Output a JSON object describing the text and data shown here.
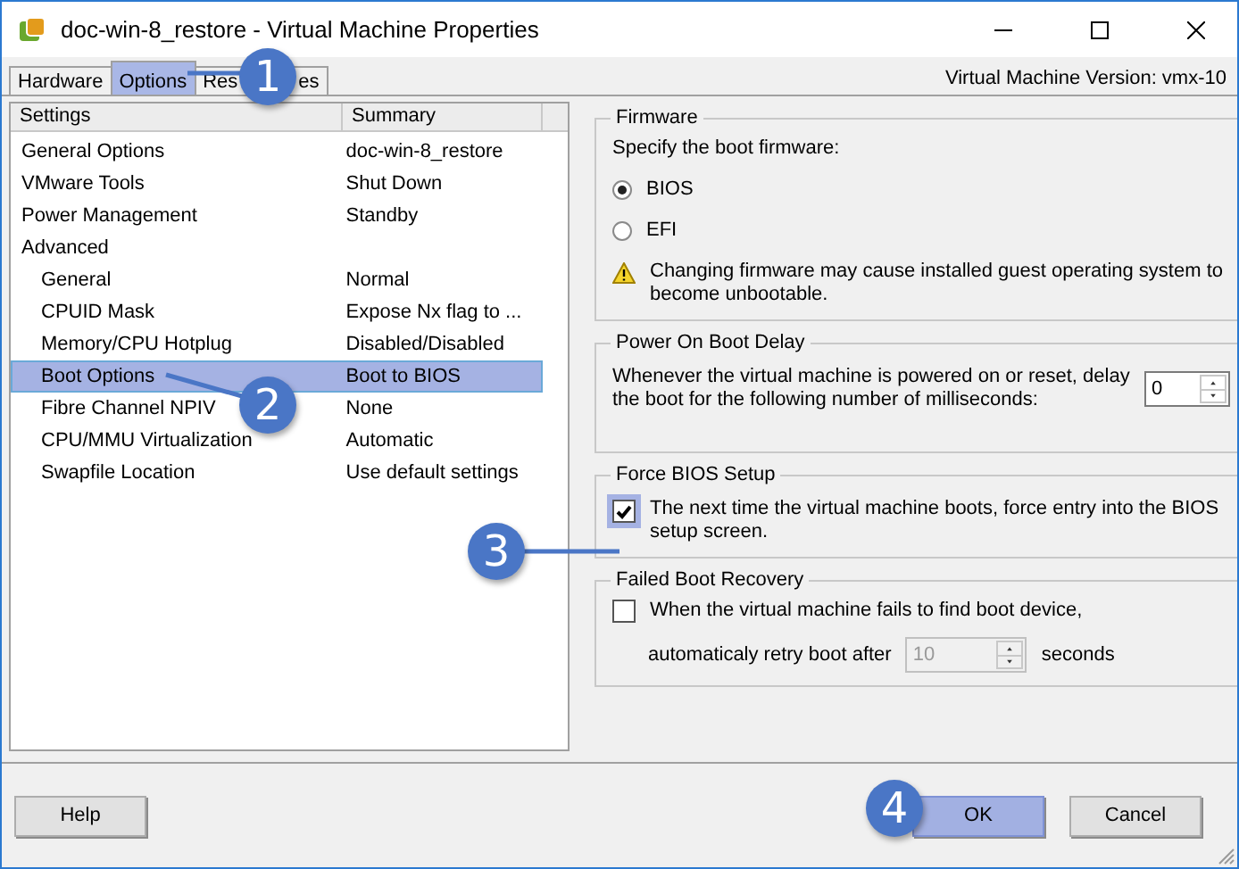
{
  "window": {
    "title": "doc-win-8_restore - Virtual Machine Properties"
  },
  "tabs": [
    {
      "label": "Hardware",
      "selected": false
    },
    {
      "label": "Options",
      "selected": true
    },
    {
      "label_parts": [
        "Res",
        "es"
      ],
      "selected": false
    }
  ],
  "version": "Virtual Machine Version: vmx-10",
  "settings_table": {
    "columns": [
      "Settings",
      "Summary"
    ],
    "rows": [
      {
        "setting": "General Options",
        "summary": "doc-win-8_restore",
        "selected": false
      },
      {
        "setting": "VMware Tools",
        "summary": "Shut Down",
        "selected": false
      },
      {
        "setting": "Power Management",
        "summary": "Standby",
        "selected": false
      },
      {
        "setting": "Advanced",
        "selected": false,
        "children": [
          {
            "setting": "General",
            "summary": "Normal",
            "selected": false
          },
          {
            "setting": "CPUID Mask",
            "summary": "Expose Nx flag to ...",
            "selected": false
          },
          {
            "setting": "Memory/CPU Hotplug",
            "summary": "Disabled/Disabled",
            "selected": false
          },
          {
            "setting": "Boot Options",
            "summary": "Boot to BIOS",
            "selected": true
          },
          {
            "setting": "Fibre Channel NPIV",
            "summary": "None",
            "selected": false
          },
          {
            "setting": "CPU/MMU Virtualization",
            "summary": "Automatic",
            "selected": false
          },
          {
            "setting": "Swapfile Location",
            "summary": "Use default settings",
            "selected": false
          }
        ]
      }
    ]
  },
  "firmware": {
    "title": "Firmware",
    "prompt": "Specify the boot firmware:",
    "options": [
      {
        "label": "BIOS",
        "selected": true
      },
      {
        "label": "EFI",
        "selected": false
      }
    ],
    "warning": "Changing firmware may cause installed guest operating system to become unbootable."
  },
  "boot_delay": {
    "title": "Power On Boot Delay",
    "description": "Whenever the virtual machine is powered on or reset, delay the boot for the following number of milliseconds:",
    "value": "0"
  },
  "force_bios": {
    "title": "Force BIOS Setup",
    "label": "The next time the virtual machine boots, force entry into the BIOS setup screen.",
    "checked": true
  },
  "failed_recovery": {
    "title": "Failed Boot Recovery",
    "label": "When the virtual machine fails to find boot device,",
    "checked": false,
    "retry_label": "automaticaly retry boot after",
    "value": "10",
    "disabled": true,
    "unit": "seconds"
  },
  "buttons": [
    {
      "label": "Help",
      "highlighted": false
    },
    {
      "label": "OK",
      "highlighted": true
    },
    {
      "label": "Cancel",
      "highlighted": false
    }
  ],
  "callouts": [
    {
      "number": "1"
    },
    {
      "number": "2"
    },
    {
      "number": "3"
    },
    {
      "number": "4"
    }
  ]
}
